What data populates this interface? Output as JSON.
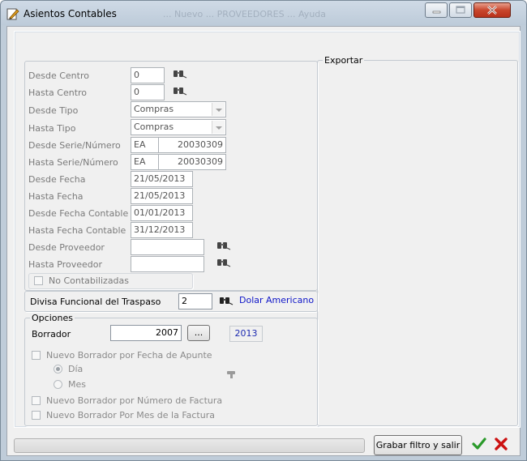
{
  "window": {
    "title": "Asientos Contables",
    "title_ghost": "... Nuevo  ... PROVEEDORES  ... Ayuda"
  },
  "filtros": {
    "desde_centro": {
      "label": "Desde Centro",
      "value": "0"
    },
    "hasta_centro": {
      "label": "Hasta Centro",
      "value": "0"
    },
    "desde_tipo": {
      "label": "Desde Tipo",
      "value": "Compras"
    },
    "hasta_tipo": {
      "label": "Hasta Tipo",
      "value": "Compras"
    },
    "desde_serie": {
      "label": "Desde Serie/Número",
      "serie": "EA",
      "numero": "20030309"
    },
    "hasta_serie": {
      "label": "Hasta Serie/Número",
      "serie": "EA",
      "numero": "20030309"
    },
    "desde_fecha": {
      "label": "Desde Fecha",
      "value": "21/05/2013"
    },
    "hasta_fecha": {
      "label": "Hasta Fecha",
      "value": "21/05/2013"
    },
    "desde_fecha_contable": {
      "label": "Desde Fecha Contable",
      "value": "01/01/2013"
    },
    "hasta_fecha_contable": {
      "label": "Hasta Fecha Contable",
      "value": "31/12/2013"
    },
    "desde_proveedor": {
      "label": "Desde Proveedor",
      "value": ""
    },
    "hasta_proveedor": {
      "label": "Hasta Proveedor",
      "value": ""
    },
    "no_contabilizadas": {
      "label": "No Contabilizadas",
      "checked": false
    }
  },
  "divisa": {
    "label": "Divisa Funcional del Traspaso",
    "value": "2",
    "name": "Dolar Americano"
  },
  "opciones": {
    "title": "Opciones",
    "borrador_label": "Borrador",
    "borrador_value": "2007",
    "browse_label": "...",
    "year": "2013",
    "nuevo_por_fecha": {
      "label": "Nuevo Borrador por Fecha de Apunte",
      "checked": false
    },
    "radio_dia": {
      "label": "Día",
      "checked": true
    },
    "radio_mes": {
      "label": "Mes",
      "checked": false
    },
    "nuevo_por_numero": {
      "label": "Nuevo Borrador por Número de Factura",
      "checked": false
    },
    "nuevo_por_mes": {
      "label": "Nuevo Borrador Por Mes de la Factura",
      "checked": false
    }
  },
  "exportar": {
    "title": "Exportar"
  },
  "footer": {
    "save_filter_label": "Grabar filtro y salir"
  },
  "colors": {
    "accept": "#2a9a2a",
    "cancel": "#cc1111",
    "link": "#0f16c8"
  }
}
